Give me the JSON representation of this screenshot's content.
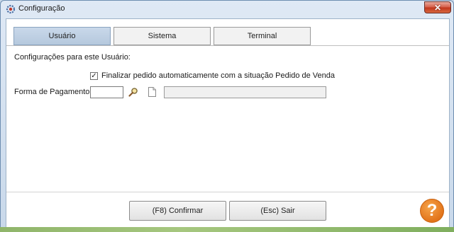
{
  "window": {
    "title": "Configuração",
    "close_label": "✕"
  },
  "tabs": [
    {
      "label": "Usuário",
      "active": true
    },
    {
      "label": "Sistema",
      "active": false
    },
    {
      "label": "Terminal",
      "active": false
    }
  ],
  "usuario": {
    "section_label": "Configurações para este Usuário:",
    "finalizar_checkbox": {
      "checked": true,
      "mark": "✓",
      "label": "Finalizar pedido automaticamente com a situação Pedido de Venda"
    },
    "forma_pagamento": {
      "label": "Forma de Pagamento:",
      "code_value": "",
      "description_value": ""
    }
  },
  "footer": {
    "confirm_label": "(F8) Confirmar",
    "exit_label": "(Esc) Sair",
    "help_glyph": "?"
  },
  "colors": {
    "active_tab": "#bfd0e4",
    "help_icon": "#e8801f",
    "close_button": "#c9432b"
  }
}
